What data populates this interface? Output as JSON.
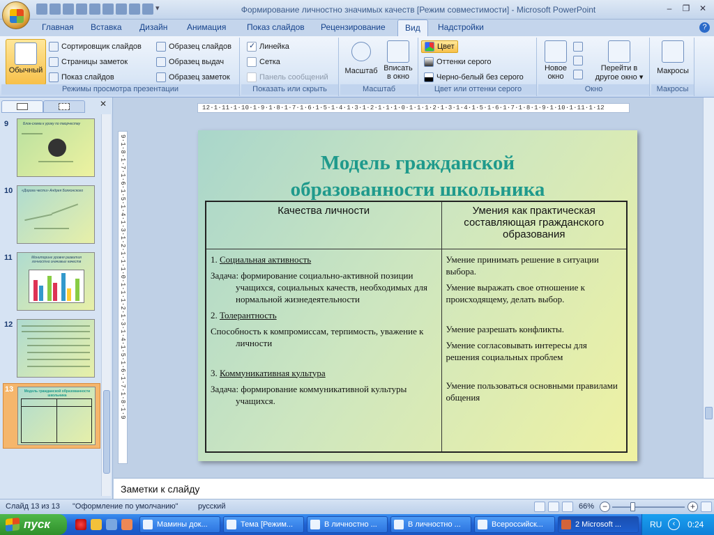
{
  "window": {
    "title": "Формирование личностно значимых качеств [Режим совместимости]",
    "app_name": "Microsoft PowerPoint"
  },
  "ribbon_tabs": [
    "Главная",
    "Вставка",
    "Дизайн",
    "Анимация",
    "Показ слайдов",
    "Рецензирование",
    "Вид",
    "Надстройки"
  ],
  "active_tab": "Вид",
  "ribbon": {
    "views": {
      "normal": "Обычный",
      "slide_sorter": "Сортировщик слайдов",
      "notes_page": "Страницы заметок",
      "slide_show": "Показ слайдов",
      "slide_master": "Образец слайдов",
      "handout_master": "Образец выдач",
      "notes_master": "Образец заметок",
      "label": "Режимы просмотра презентации"
    },
    "show_hide": {
      "ruler": "Линейка",
      "gridlines": "Сетка",
      "message_bar": "Панель сообщений",
      "label": "Показать или скрыть",
      "ruler_checked": true,
      "gridlines_checked": false
    },
    "zoom": {
      "zoom": "Масштаб",
      "fit_line1": "Вписать",
      "fit_line2": "в окно",
      "label": "Масштаб"
    },
    "color": {
      "color": "Цвет",
      "grayscale": "Оттенки серого",
      "bw": "Черно-белый без серого",
      "label": "Цвет или оттенки серого"
    },
    "window": {
      "new_line1": "Новое",
      "new_line2": "окно",
      "switch_line1": "Перейти в",
      "switch_line2": "другое окно",
      "label": "Окно"
    },
    "macros": {
      "macros": "Макросы",
      "label": "Макросы"
    }
  },
  "slides_pane": {
    "thumbnails": [
      {
        "num": "9",
        "title": "Блок-схема к уроку по творчеству"
      },
      {
        "num": "10",
        "title": "«Дорога чести» Андрея Болконского"
      },
      {
        "num": "11",
        "title": "Мониторинг уровня развития личностно значимых качеств"
      },
      {
        "num": "12",
        "title": ""
      },
      {
        "num": "13",
        "title": "Модель гражданской образованности школьника"
      }
    ],
    "selected": "13"
  },
  "ruler": {
    "horizontal": "12·1·11·1·10·1·9·1·8·1·7·1·6·1·5·1·4·1·3·1·2·1·1·1·0·1·1·1·2·1·3·1·4·1·5·1·6·1·7·1·8·1·9·1·10·1·11·1·12",
    "vertical": "9·1·8·1·7·1·6·1·5·1·4·1·3·1·2·1·1·1·0·1·1·1·2·1·3·1·4·1·5·1·6·1·7·1·8·1·9"
  },
  "slide": {
    "title_line1": "Модель гражданской",
    "title_line2": "образованности школьника",
    "table": {
      "col1_header": "Качества личности",
      "col2_header": "Умения как практическая составляющая гражданского образования",
      "left": {
        "q1_num": "1. ",
        "q1_title": "Социальная активность",
        "q1_text": "Задача: формирование социально-активной позиции учащихся, социальных качеств, необходимых для нормальной жизнедеятельности",
        "q2_num": "2. ",
        "q2_title": "Толерантность",
        "q2_text": "Способность к компромиссам, терпимость, уважение к личности",
        "q3_num": "3. ",
        "q3_title": "Коммуникативная культура",
        "q3_text": "Задача: формирование коммуникативной культуры учащихся."
      },
      "right": {
        "s1": "Умение принимать решение в ситуации выбора.",
        "s2": "Умение выражать свое отношение к происходящему, делать выбор.",
        "s3": "Умение разрешать конфликты.",
        "s4": "Умение согласовывать интересы для решения социальных проблем",
        "s5": "Умение пользоваться основными правилами общения"
      }
    }
  },
  "notes": {
    "placeholder": "Заметки к слайду"
  },
  "status_bar": {
    "slide_info": "Слайд 13 из 13",
    "theme": "\"Оформление по умолчанию\"",
    "language": "русский",
    "zoom": "66%"
  },
  "taskbar": {
    "start": "пуск",
    "tasks": [
      {
        "label": "Мамины док...",
        "active": false
      },
      {
        "label": "Тема [Режим...",
        "active": false
      },
      {
        "label": "В личностно ...",
        "active": false
      },
      {
        "label": "В личностно ...",
        "active": false
      },
      {
        "label": "Всероссийск...",
        "active": false
      },
      {
        "label": "2 Microsoft ...",
        "active": true
      }
    ],
    "lang": "RU",
    "clock": "0:24"
  },
  "colors": {
    "title_accent": "#1f9a8c",
    "ribbon_bg": "#d9e6f6",
    "selection": "#f5b66c",
    "taskbar": "#1f62d3"
  }
}
